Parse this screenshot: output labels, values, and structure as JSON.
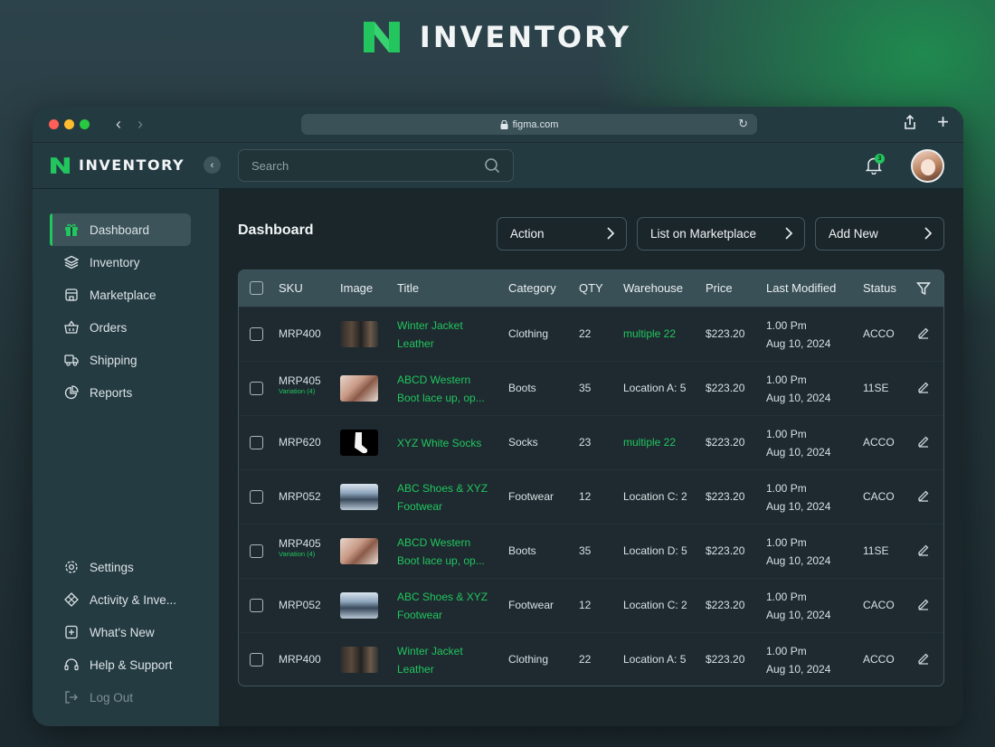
{
  "brand": {
    "name": "INVENTORY"
  },
  "browser": {
    "url": "figma.com"
  },
  "header": {
    "logo_text": "INVENTORY",
    "search_placeholder": "Search",
    "notification_count": "3"
  },
  "sidebar": {
    "items": [
      {
        "label": "Dashboard",
        "icon": "gift-icon",
        "active": true
      },
      {
        "label": "Inventory",
        "icon": "layers-icon"
      },
      {
        "label": "Marketplace",
        "icon": "store-icon"
      },
      {
        "label": "Orders",
        "icon": "basket-icon"
      },
      {
        "label": "Shipping",
        "icon": "truck-icon"
      },
      {
        "label": "Reports",
        "icon": "pie-chart-icon"
      }
    ],
    "bottom_items": [
      {
        "label": "Settings",
        "icon": "gear-icon"
      },
      {
        "label": "Activity & Inve...",
        "icon": "activity-icon"
      },
      {
        "label": "What's New",
        "icon": "news-icon"
      },
      {
        "label": "Help & Support",
        "icon": "headset-icon"
      },
      {
        "label": "Log Out",
        "icon": "logout-icon"
      }
    ]
  },
  "main": {
    "title": "Dashboard",
    "buttons": {
      "action": "Action",
      "list_marketplace": "List on Marketplace",
      "add_new": "Add New"
    }
  },
  "table": {
    "columns": [
      "SKU",
      "Image",
      "Title",
      "Category",
      "QTY",
      "Warehouse",
      "Price",
      "Last Modified",
      "Status"
    ],
    "rows": [
      {
        "sku": "MRP400",
        "variation": "",
        "image": "jacket",
        "title1": "Winter Jacket",
        "title2": "Leather",
        "category": "Clothing",
        "qty": "22",
        "warehouse": "multiple 22",
        "warehouse_green": true,
        "price": "$223.20",
        "time": "1.00 Pm",
        "date": "Aug 10, 2024",
        "status": "ACCO"
      },
      {
        "sku": "MRP405",
        "variation": "Variation (4)",
        "image": "boots",
        "title1": "ABCD Western",
        "title2": "Boot lace up, op...",
        "category": "Boots",
        "qty": "35",
        "warehouse": "Location A: 5",
        "warehouse_green": false,
        "price": "$223.20",
        "time": "1.00 Pm",
        "date": "Aug 10, 2024",
        "status": "11SE"
      },
      {
        "sku": "MRP620",
        "variation": "",
        "image": "socks",
        "title1": "XYZ White Socks",
        "title2": "",
        "category": "Socks",
        "qty": "23",
        "warehouse": "multiple 22",
        "warehouse_green": true,
        "price": "$223.20",
        "time": "1.00 Pm",
        "date": "Aug 10, 2024",
        "status": "ACCO"
      },
      {
        "sku": "MRP052",
        "variation": "",
        "image": "shoes",
        "title1": "ABC Shoes & XYZ",
        "title2": "Footwear",
        "category": "Footwear",
        "qty": "12",
        "warehouse": "Location C: 2",
        "warehouse_green": false,
        "price": "$223.20",
        "time": "1.00 Pm",
        "date": "Aug 10, 2024",
        "status": "CACO"
      },
      {
        "sku": "MRP405",
        "variation": "Variation (4)",
        "image": "boots",
        "title1": "ABCD Western",
        "title2": "Boot lace up, op...",
        "category": "Boots",
        "qty": "35",
        "warehouse": "Location D: 5",
        "warehouse_green": false,
        "price": "$223.20",
        "time": "1.00 Pm",
        "date": "Aug 10, 2024",
        "status": "11SE"
      },
      {
        "sku": "MRP052",
        "variation": "",
        "image": "shoes",
        "title1": "ABC Shoes & XYZ",
        "title2": "Footwear",
        "category": "Footwear",
        "qty": "12",
        "warehouse": "Location C: 2",
        "warehouse_green": false,
        "price": "$223.20",
        "time": "1.00 Pm",
        "date": "Aug 10, 2024",
        "status": "CACO"
      },
      {
        "sku": "MRP400",
        "variation": "",
        "image": "jacket",
        "title1": "Winter Jacket",
        "title2": "Leather",
        "category": "Clothing",
        "qty": "22",
        "warehouse": "Location A: 5",
        "warehouse_green": false,
        "price": "$223.20",
        "time": "1.00 Pm",
        "date": "Aug 10, 2024",
        "status": "ACCO"
      }
    ]
  },
  "colors": {
    "accent": "#22c55e",
    "window_bg": "#1d2a30",
    "sidebar_bg": "#253b42",
    "table_header": "#3a5057"
  }
}
